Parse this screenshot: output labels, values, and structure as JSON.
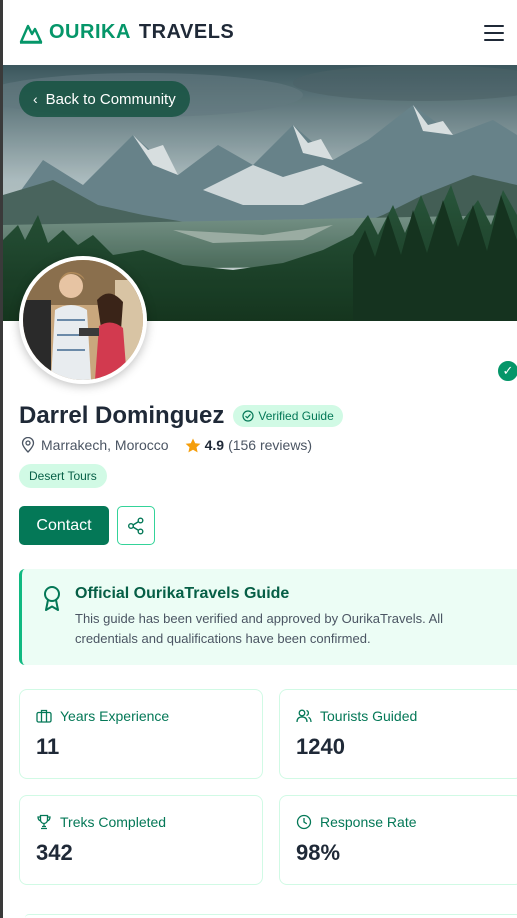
{
  "header": {
    "brand_primary": "OURIKA",
    "brand_secondary": "TRAVELS",
    "logo_icon": "mountain-logo-icon",
    "menu_icon": "hamburger-menu-icon"
  },
  "hero": {
    "back_label": "Back to Community",
    "back_icon": "chevron-left-icon"
  },
  "profile": {
    "name": "Darrel Dominguez",
    "verified_label": "Verified Guide",
    "location": "Marrakech, Morocco",
    "rating": "4.9",
    "reviews": "(156 reviews)",
    "tag": "Desert Tours",
    "contact_label": "Contact"
  },
  "official": {
    "title": "Official OurikaTravels Guide",
    "text": "This guide has been verified and approved by OurikaTravels. All credentials and qualifications have been confirmed."
  },
  "stats": [
    {
      "label": "Years Experience",
      "value": "11",
      "icon": "briefcase-icon"
    },
    {
      "label": "Tourists Guided",
      "value": "1240",
      "icon": "users-icon"
    },
    {
      "label": "Treks Completed",
      "value": "342",
      "icon": "trophy-icon"
    },
    {
      "label": "Response Rate",
      "value": "98%",
      "icon": "clock-icon"
    }
  ],
  "colors": {
    "accent": "#059669",
    "accent_dark": "#047857",
    "accent_light": "#d1fae5",
    "panel_bg": "#ecfdf5",
    "star": "#f59e0b"
  }
}
